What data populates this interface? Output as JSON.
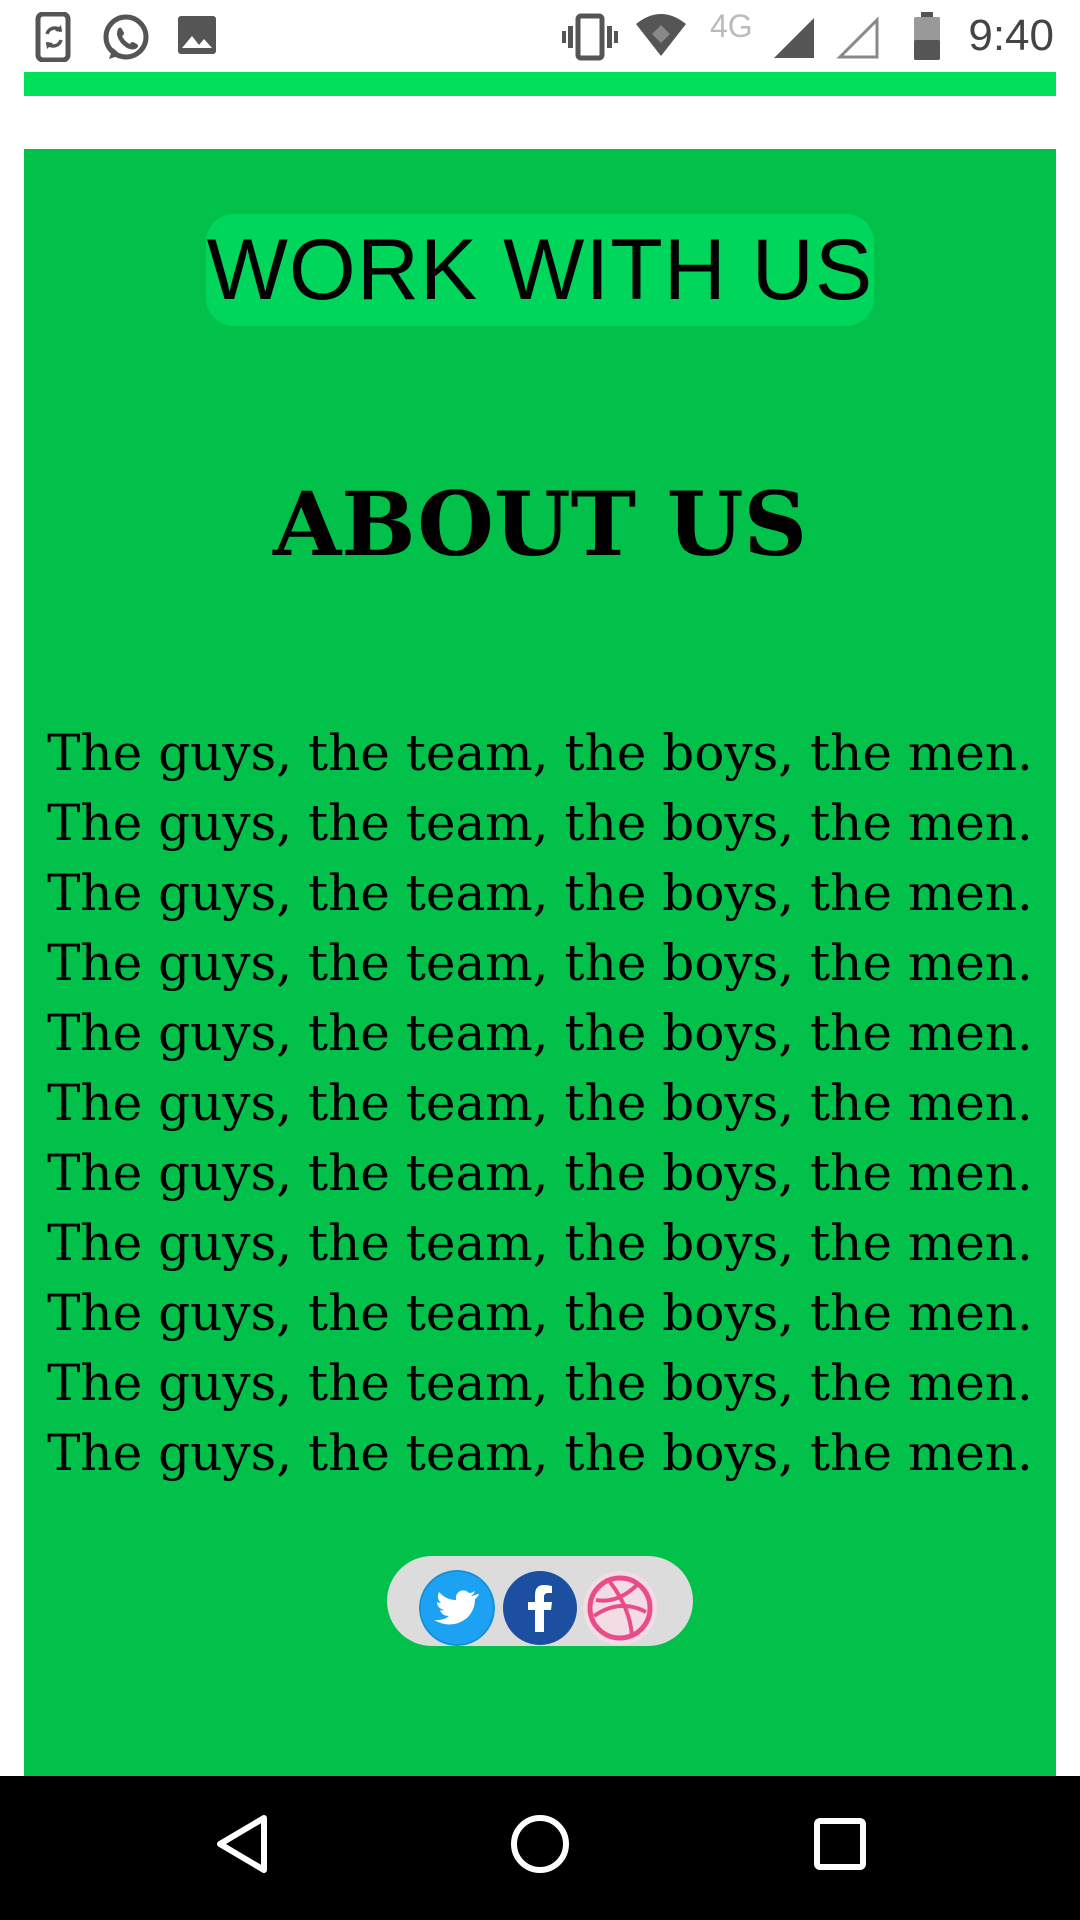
{
  "status_bar": {
    "time": "9:40",
    "network": "4G",
    "left_icons": [
      "phone-sync-icon",
      "whatsapp-icon",
      "image-icon"
    ],
    "right_icons": [
      "vibrate-icon",
      "wifi-icon",
      "signal-icon",
      "signal-empty-icon",
      "battery-icon"
    ]
  },
  "page": {
    "work_button_label": "WORK WITH US",
    "about_title": "ABOUT US",
    "about_lines": [
      "The guys, the team, the boys, the men.",
      "The guys, the team, the boys, the men.",
      "The guys, the team, the boys, the men.",
      "The guys, the team, the boys, the men.",
      "The guys, the team, the boys, the men.",
      "The guys, the team, the boys, the men.",
      "The guys, the team, the boys, the men.",
      "The guys, the team, the boys, the men.",
      "The guys, the team, the boys, the men.",
      "The guys, the team, the boys, the men.",
      "The guys, the team, the boys, the men."
    ],
    "social": [
      "twitter-icon",
      "facebook-icon",
      "dribbble-icon"
    ]
  },
  "nav_bar": {
    "icons": [
      "back-icon",
      "home-icon",
      "recents-icon"
    ]
  },
  "colors": {
    "card_green": "#02c14a",
    "strip_green": "#00e05a",
    "button_green": "#00d65c",
    "twitter_blue": "#1da1f2",
    "facebook_blue": "#1c4fa0",
    "dribbble_pink": "#ea4c89"
  }
}
